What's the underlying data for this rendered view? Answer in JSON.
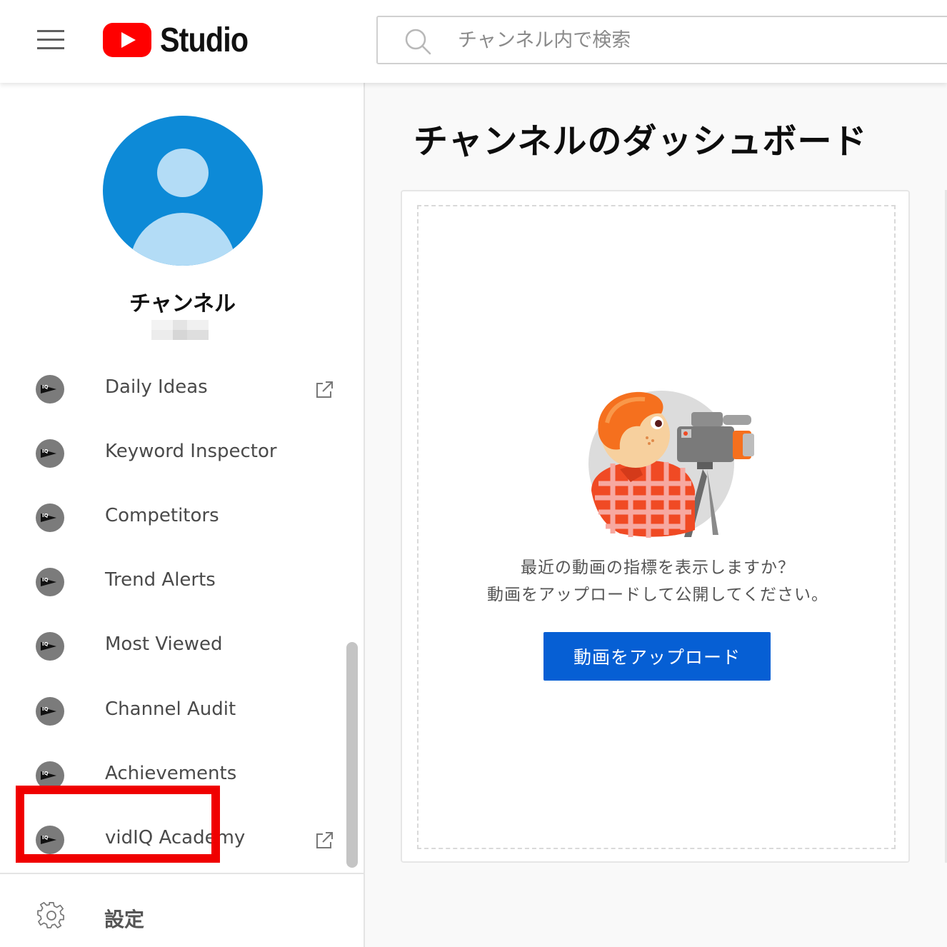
{
  "header": {
    "logo_text": "Studio",
    "search_placeholder": "チャンネル内で検索"
  },
  "sidebar": {
    "channel_name": "チャンネル",
    "items": [
      {
        "label": "Daily Ideas",
        "external": true
      },
      {
        "label": "Keyword Inspector",
        "external": false
      },
      {
        "label": "Competitors",
        "external": false
      },
      {
        "label": "Trend Alerts",
        "external": false
      },
      {
        "label": "Most Viewed",
        "external": false
      },
      {
        "label": "Channel Audit",
        "external": false
      },
      {
        "label": "Achievements",
        "external": false
      },
      {
        "label": "vidIQ Academy",
        "external": true
      }
    ],
    "settings_label": "設定"
  },
  "main": {
    "title": "チャンネルのダッシュボード",
    "empty_line1": "最近の動画の指標を表示しますか？",
    "empty_line2": "動画をアップロードして公開してください。",
    "upload_button": "動画をアップロード"
  },
  "colors": {
    "brand_red": "#ff0000",
    "avatar_blue": "#0d8ad7",
    "button_blue": "#065fd4",
    "highlight_red": "#f00000"
  },
  "icons": {
    "menu": "hamburger-icon",
    "search": "search-icon",
    "menu_item": "vidiq-icon",
    "external": "external-link-icon",
    "settings": "gear-icon"
  }
}
